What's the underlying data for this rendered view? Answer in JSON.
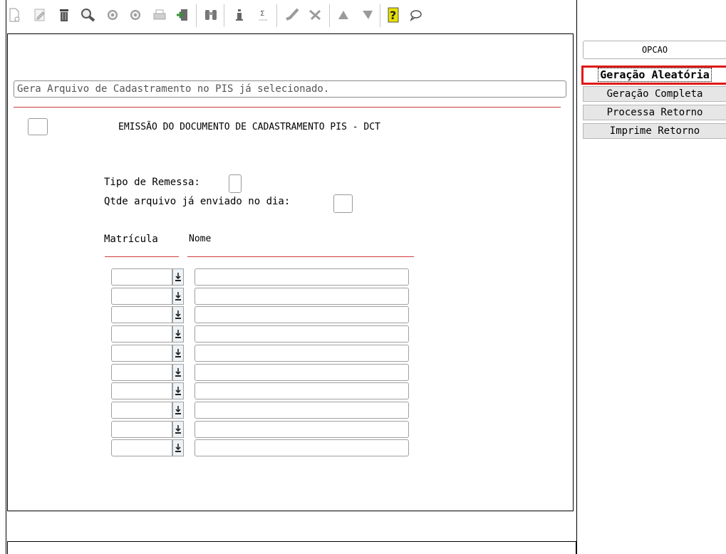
{
  "toolbar": {
    "icons": [
      "new-document-icon",
      "edit-icon",
      "trash-icon",
      "search-icon",
      "circle-icon",
      "circle-icon-2",
      "print-icon",
      "exit-icon",
      "binoculars-icon",
      "info-icon",
      "sigma-icon",
      "check-icon",
      "cancel-icon",
      "up-icon",
      "filter-icon",
      "help-icon",
      "comment-icon"
    ]
  },
  "message": "Gera Arquivo de Cadastramento no PIS já selecionado.",
  "form": {
    "title": "EMISSÃO DO DOCUMENTO DE CADASTRAMENTO PIS - DCT",
    "tipo_remessa_label": "Tipo de Remessa:",
    "qtde_label": "Qtde arquivo já enviado no dia:"
  },
  "table": {
    "headers": {
      "matricula": "Matrícula",
      "nome": "Nome"
    },
    "rows": [
      {
        "matricula": "",
        "nome": ""
      },
      {
        "matricula": "",
        "nome": ""
      },
      {
        "matricula": "",
        "nome": ""
      },
      {
        "matricula": "",
        "nome": ""
      },
      {
        "matricula": "",
        "nome": ""
      },
      {
        "matricula": "",
        "nome": ""
      },
      {
        "matricula": "",
        "nome": ""
      },
      {
        "matricula": "",
        "nome": ""
      },
      {
        "matricula": "",
        "nome": ""
      },
      {
        "matricula": "",
        "nome": ""
      }
    ]
  },
  "options": {
    "header": "OPCAO",
    "items": [
      "Geração Aleatória",
      "Geração Completa",
      "Processa Retorno",
      "Imprime Retorno"
    ],
    "selected_index": 0,
    "highlight_color": "#e01818"
  },
  "colors": {
    "accent_line": "#d23b3b"
  }
}
